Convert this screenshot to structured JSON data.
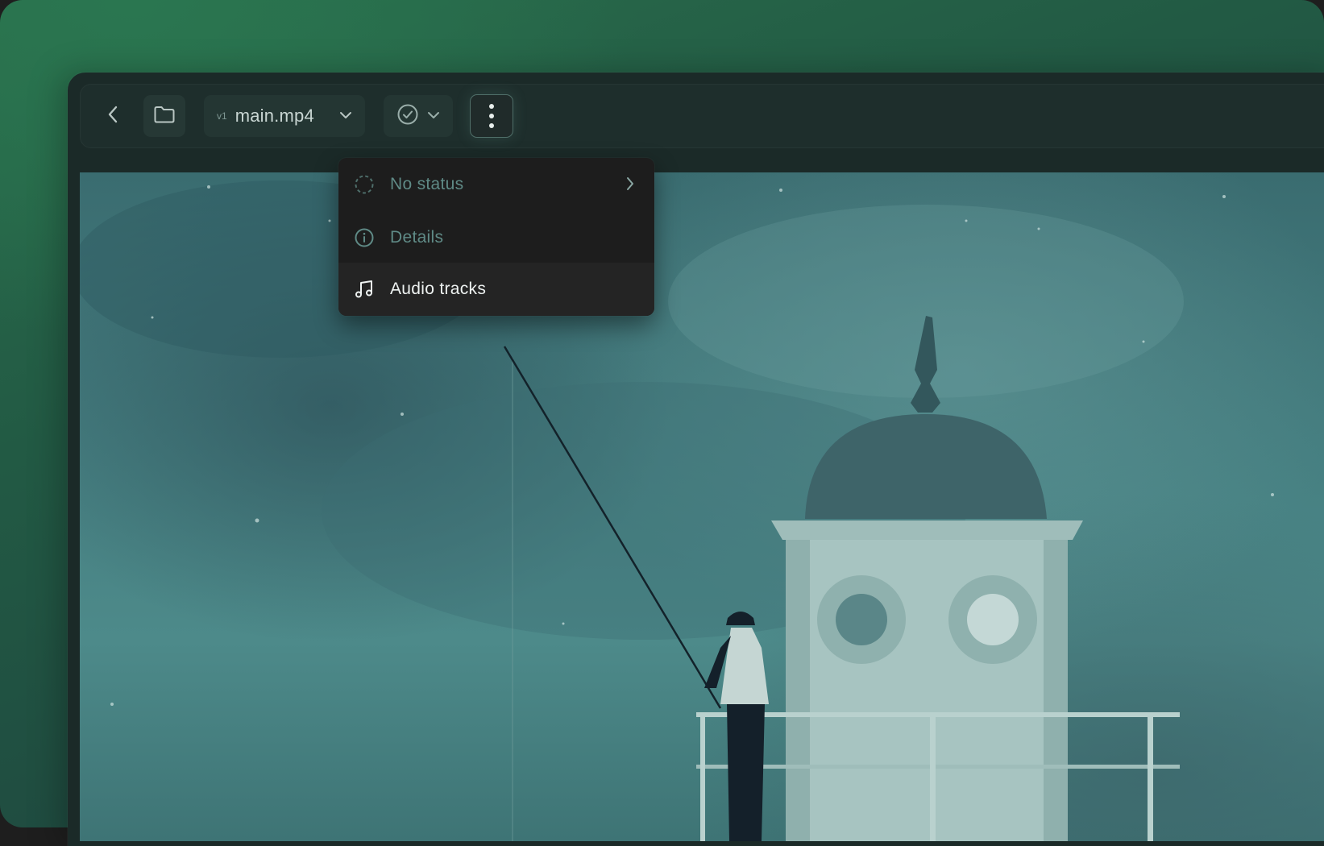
{
  "toolbar": {
    "back_icon": "chevron-left-icon",
    "folder_icon": "folder-icon",
    "file": {
      "version": "v1",
      "name": "main.mp4"
    },
    "status_icon": "check-circle-icon",
    "more_icon": "more-vertical-icon"
  },
  "menu": {
    "items": [
      {
        "label": "No status",
        "icon": "dashed-circle-icon",
        "has_submenu": true
      },
      {
        "label": "Details",
        "icon": "info-icon"
      },
      {
        "label": "Audio tracks",
        "icon": "music-note-icon",
        "highlighted": true
      }
    ]
  },
  "colors": {
    "background": "#256a4b",
    "menu_background": "#1d1d1d",
    "muted_text": "#5f8a86",
    "active_text": "#eef2f1"
  }
}
